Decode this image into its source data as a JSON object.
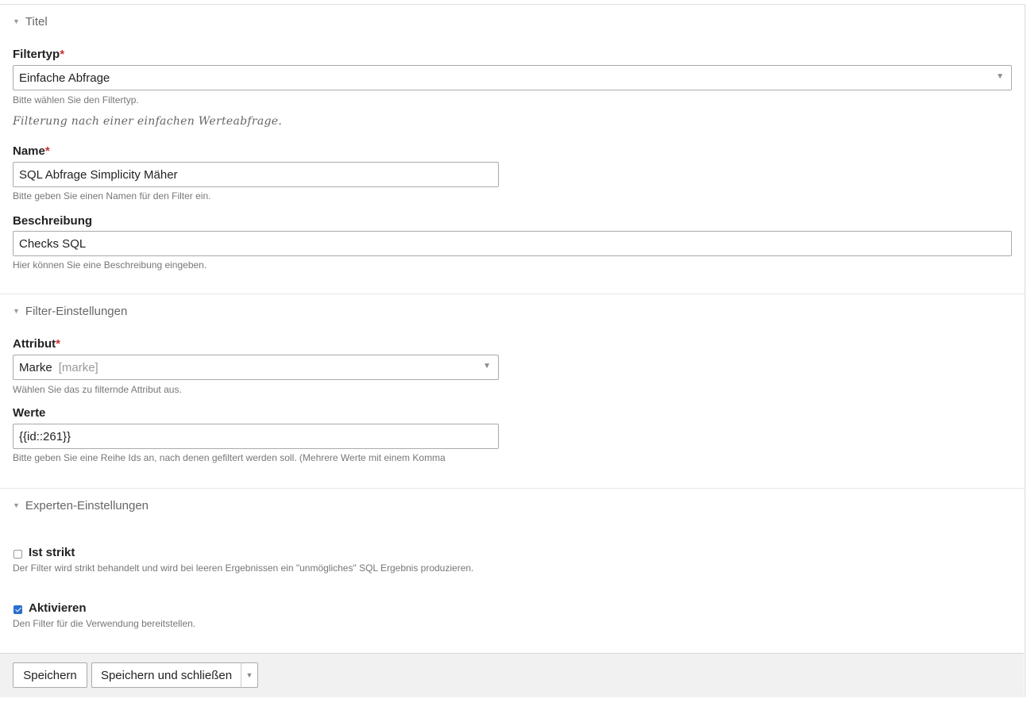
{
  "sections": {
    "title": {
      "legend": "Titel"
    },
    "filter_settings": {
      "legend": "Filter-Einstellungen"
    },
    "expert_settings": {
      "legend": "Experten-Einstellungen"
    }
  },
  "filtertyp": {
    "label": "Filtertyp",
    "required_mark": "*",
    "value": "Einfache Abfrage",
    "help": "Bitte wählen Sie den Filtertyp.",
    "description": "Filterung nach einer einfachen Werteabfrage."
  },
  "name": {
    "label": "Name",
    "required_mark": "*",
    "value": "SQL Abfrage Simplicity Mäher",
    "help": "Bitte geben Sie einen Namen für den Filter ein."
  },
  "beschreibung": {
    "label": "Beschreibung",
    "value": "Checks SQL",
    "help": "Hier können Sie eine Beschreibung eingeben."
  },
  "attribut": {
    "label": "Attribut",
    "required_mark": "*",
    "value": "Marke",
    "value_sub": "[marke]",
    "help": "Wählen Sie das zu filternde Attribut aus."
  },
  "werte": {
    "label": "Werte",
    "value": "{{id::261}}",
    "help": "Bitte geben Sie eine Reihe Ids an, nach denen gefiltert werden soll. (Mehrere Werte mit einem Komma"
  },
  "ist_strikt": {
    "label": "Ist strikt",
    "checked": false,
    "help": "Der Filter wird strikt behandelt und wird bei leeren Ergebnissen ein \"unmögliches\" SQL Ergebnis produzieren."
  },
  "aktivieren": {
    "label": "Aktivieren",
    "checked": true,
    "help": "Den Filter für die Verwendung bereitstellen."
  },
  "footer": {
    "save_label": "Speichern",
    "save_close_label": "Speichern und schließen"
  },
  "icons": {
    "collapse": "triangle-down-icon",
    "dropdown": "chevron-down-icon"
  },
  "colors": {
    "required": "#cc3333",
    "checkbox_checked": "#2a6ed0",
    "footer_bg": "#f1f1f1"
  }
}
